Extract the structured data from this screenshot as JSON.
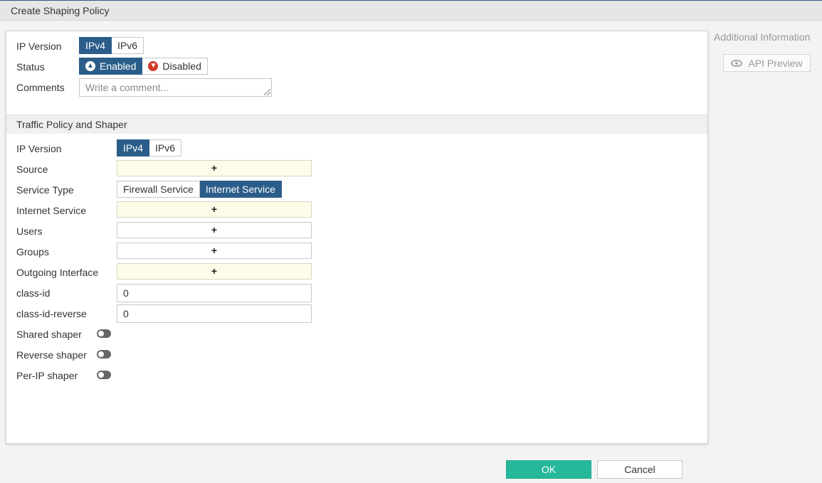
{
  "window": {
    "title": "Create Shaping Policy"
  },
  "general": {
    "ip_version_label": "IP Version",
    "ip_version_options": [
      "IPv4",
      "IPv6"
    ],
    "status_label": "Status",
    "status_enabled": "Enabled",
    "status_disabled": "Disabled",
    "comments_label": "Comments",
    "comments_placeholder": "Write a comment..."
  },
  "traffic": {
    "section_title": "Traffic Policy and Shaper",
    "ip_version_label": "IP Version",
    "ip_version_options": [
      "IPv4",
      "IPv6"
    ],
    "source_label": "Source",
    "service_type_label": "Service Type",
    "service_type_options": [
      "Firewall Service",
      "Internet Service"
    ],
    "internet_service_label": "Internet Service",
    "users_label": "Users",
    "groups_label": "Groups",
    "outgoing_interface_label": "Outgoing Interface",
    "add_symbol": "+",
    "class_id_label": "class-id",
    "class_id_value": "0",
    "class_id_reverse_label": "class-id-reverse",
    "class_id_reverse_value": "0",
    "shared_shaper_label": "Shared shaper",
    "reverse_shaper_label": "Reverse shaper",
    "per_ip_shaper_label": "Per-IP shaper"
  },
  "sidebar": {
    "title": "Additional Information",
    "api_preview_label": "API Preview"
  },
  "footer": {
    "ok_label": "OK",
    "cancel_label": "Cancel"
  },
  "colors": {
    "active_segment": "#2b5d8a",
    "ok_button": "#25b89a",
    "required_field": "#fcfce8"
  }
}
